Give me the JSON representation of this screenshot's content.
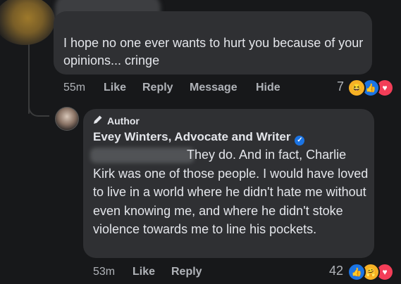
{
  "comment1": {
    "text": "I hope no one ever wants to hurt you because of your opinions... cringe",
    "time": "55m",
    "like_label": "Like",
    "reply_label": "Reply",
    "message_label": "Message",
    "hide_label": "Hide",
    "reaction_count": "7",
    "reactions": [
      "laughing-emoji",
      "like-emoji",
      "love-emoji"
    ]
  },
  "comment2": {
    "badge": "Author",
    "author_name": "Evey Winters, Advocate and Writer",
    "text": "They do.  And in fact, Charlie Kirk was one of those people.  I would have loved to live in a world where he didn't hate me without even knowing me, and where he didn't stoke violence towards me to line his pockets.",
    "time": "53m",
    "like_label": "Like",
    "reply_label": "Reply",
    "reaction_count": "42",
    "reactions": [
      "like-emoji",
      "care-emoji",
      "love-emoji"
    ]
  },
  "colors": {
    "background": "#17181a",
    "bubble": "#2f3033",
    "text": "#e4e6eb",
    "muted": "#b0b3b8",
    "like_blue": "#1b74e4",
    "love_red": "#f33e58",
    "haha_yellow": "#f7b125"
  }
}
